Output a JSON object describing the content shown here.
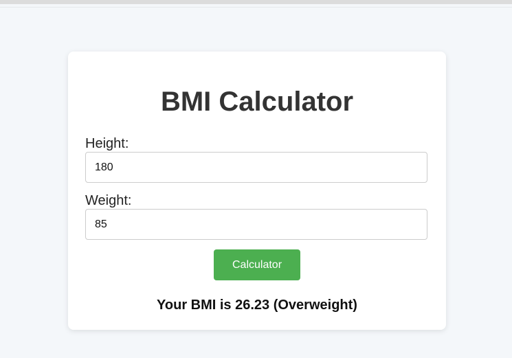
{
  "app": {
    "title": "BMI Calculator"
  },
  "form": {
    "height_label": "Height:",
    "height_value": "180",
    "weight_label": "Weight:",
    "weight_value": "85",
    "submit_label": "Calculator"
  },
  "result": {
    "text": "Your BMI is 26.23 (Overweight)"
  },
  "colors": {
    "accent": "#4caf50",
    "background": "#f4f7fa",
    "card": "#ffffff",
    "title": "#333333"
  }
}
